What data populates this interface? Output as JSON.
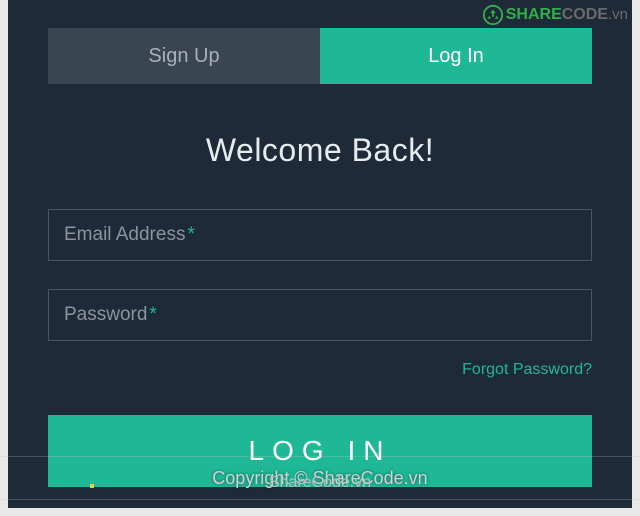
{
  "watermark": {
    "brand_share": "SHARE",
    "brand_code": "CODE",
    "brand_vn": ".vn",
    "overlay_copyright": "Copyright © ShareCode.vn",
    "overlay_mid": "ShareCode.vn"
  },
  "tabs": {
    "signup": "Sign Up",
    "login": "Log In"
  },
  "heading": "Welcome Back!",
  "form": {
    "email_label": "Email Address",
    "password_label": "Password",
    "required_mark": "*",
    "forgot": "Forgot Password?",
    "submit": "LOG IN"
  }
}
